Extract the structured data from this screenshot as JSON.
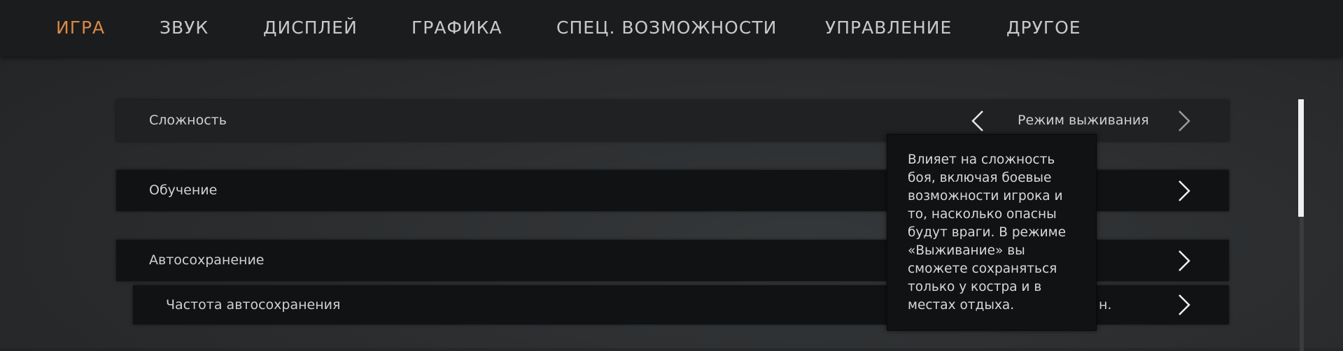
{
  "tabs": [
    {
      "label": "ИГРА"
    },
    {
      "label": "ЗВУК"
    },
    {
      "label": "ДИСПЛЕЙ"
    },
    {
      "label": "ГРАФИКА"
    },
    {
      "label": "СПЕЦ. ВОЗМОЖНОСТИ"
    },
    {
      "label": "УПРАВЛЕНИЕ"
    },
    {
      "label": "ДРУГОЕ"
    }
  ],
  "active_tab": "ИГРА",
  "settings": {
    "difficulty": {
      "label": "Сложность",
      "value": "Режим выживания"
    },
    "tutorial": {
      "label": "Обучение"
    },
    "autosave": {
      "label": "Автосохранение"
    },
    "autosave_frequency": {
      "label": "Частота автосохранения",
      "value_partial": "н."
    }
  },
  "tooltip": {
    "text": "Влияет на сложность боя, включая боевые возможности игрока и то, насколько опасны будут враги. В режиме «Выживание» вы сможете сохраняться только у костра и в местах отдыха."
  },
  "colors": {
    "accent": "#d98a45",
    "topbar": "#1b1c1d",
    "row": "#111213",
    "row_highlight": "#202122"
  },
  "icons": {
    "prev": "chevron-left-icon",
    "next": "chevron-right-icon"
  }
}
